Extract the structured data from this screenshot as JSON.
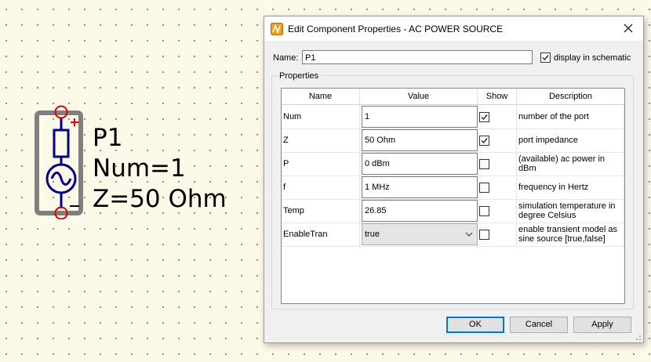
{
  "schematic": {
    "component_name": "P1",
    "property_lines": [
      "Num=1",
      "Z=50 Ohm"
    ]
  },
  "dialog": {
    "title": "Edit Component Properties - AC POWER SOURCE",
    "name_label": "Name:",
    "name_value": "P1",
    "display_in_schematic": {
      "label": "display in schematic",
      "checked": true
    },
    "group_title": "Properties",
    "columns": [
      "Name",
      "Value",
      "Show",
      "Description"
    ],
    "rows": [
      {
        "name": "Num",
        "value": "1",
        "show": true,
        "description": "number of the port"
      },
      {
        "name": "Z",
        "value": "50 Ohm",
        "show": true,
        "description": "port impedance"
      },
      {
        "name": "P",
        "value": "0 dBm",
        "show": false,
        "description": "(available) ac power in dBm"
      },
      {
        "name": "f",
        "value": "1 MHz",
        "show": false,
        "description": "frequency in Hertz"
      },
      {
        "name": "Temp",
        "value": "26.85",
        "show": false,
        "description": "simulation temperature in degree Celsius"
      },
      {
        "name": "EnableTran",
        "value": "true",
        "show": false,
        "description": "enable transient model as sine source [true,false]",
        "type": "dropdown"
      }
    ],
    "buttons": {
      "ok": "OK",
      "cancel": "Cancel",
      "apply": "Apply"
    }
  },
  "colors": {
    "accent": "#0078d7",
    "symbol_blue": "#00008b",
    "pin_red": "#e00000",
    "frame_gray": "#7f7f7f"
  },
  "icons": {
    "app": "qucs-app-icon",
    "close": "close-icon",
    "dropdown": "chevron-down-icon",
    "check": "check-icon"
  }
}
